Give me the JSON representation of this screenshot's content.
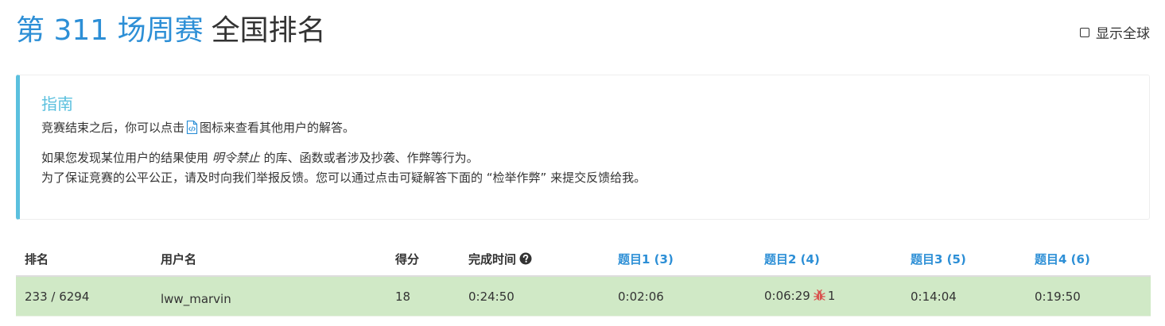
{
  "header": {
    "contest_title": "第 311 场周赛",
    "rank_title": "全国排名",
    "global_toggle_label": "显示全球"
  },
  "guide": {
    "title": "指南",
    "line1_before": "竞赛结束之后，你可以点击",
    "line1_after": "图标来查看其他用户的解答。",
    "line2_before": "如果您发现某位用户的结果使用",
    "line2_italic": "明令禁止",
    "line2_after": "的库、函数或者涉及抄袭、作弊等行为。",
    "line3": "为了保证竞赛的公平公正，请及时向我们举报反馈。您可以通过点击可疑解答下面的 “检举作弊” 来提交反馈给我。"
  },
  "table": {
    "headers": {
      "rank": "排名",
      "username": "用户名",
      "score": "得分",
      "finish_time": "完成时间",
      "q1": "题目1 (3)",
      "q2": "题目2 (4)",
      "q3": "题目3 (5)",
      "q4": "题目4 (6)"
    },
    "rows": [
      {
        "rank": "233 / 6294",
        "username": "lww_marvin",
        "score": "18",
        "finish_time": "0:24:50",
        "q1": "0:02:06",
        "q2": "0:06:29",
        "q2_penalty": "1",
        "q3": "0:14:04",
        "q4": "0:19:50"
      }
    ]
  },
  "colors": {
    "accent_blue": "#2d8fd6",
    "guide_border": "#5bc0de",
    "row_success": "#d0e9c6",
    "bug_red": "#d9534f"
  },
  "icons": {
    "code": "code-file-icon",
    "help": "question-circle-icon",
    "bug": "bug-icon"
  }
}
